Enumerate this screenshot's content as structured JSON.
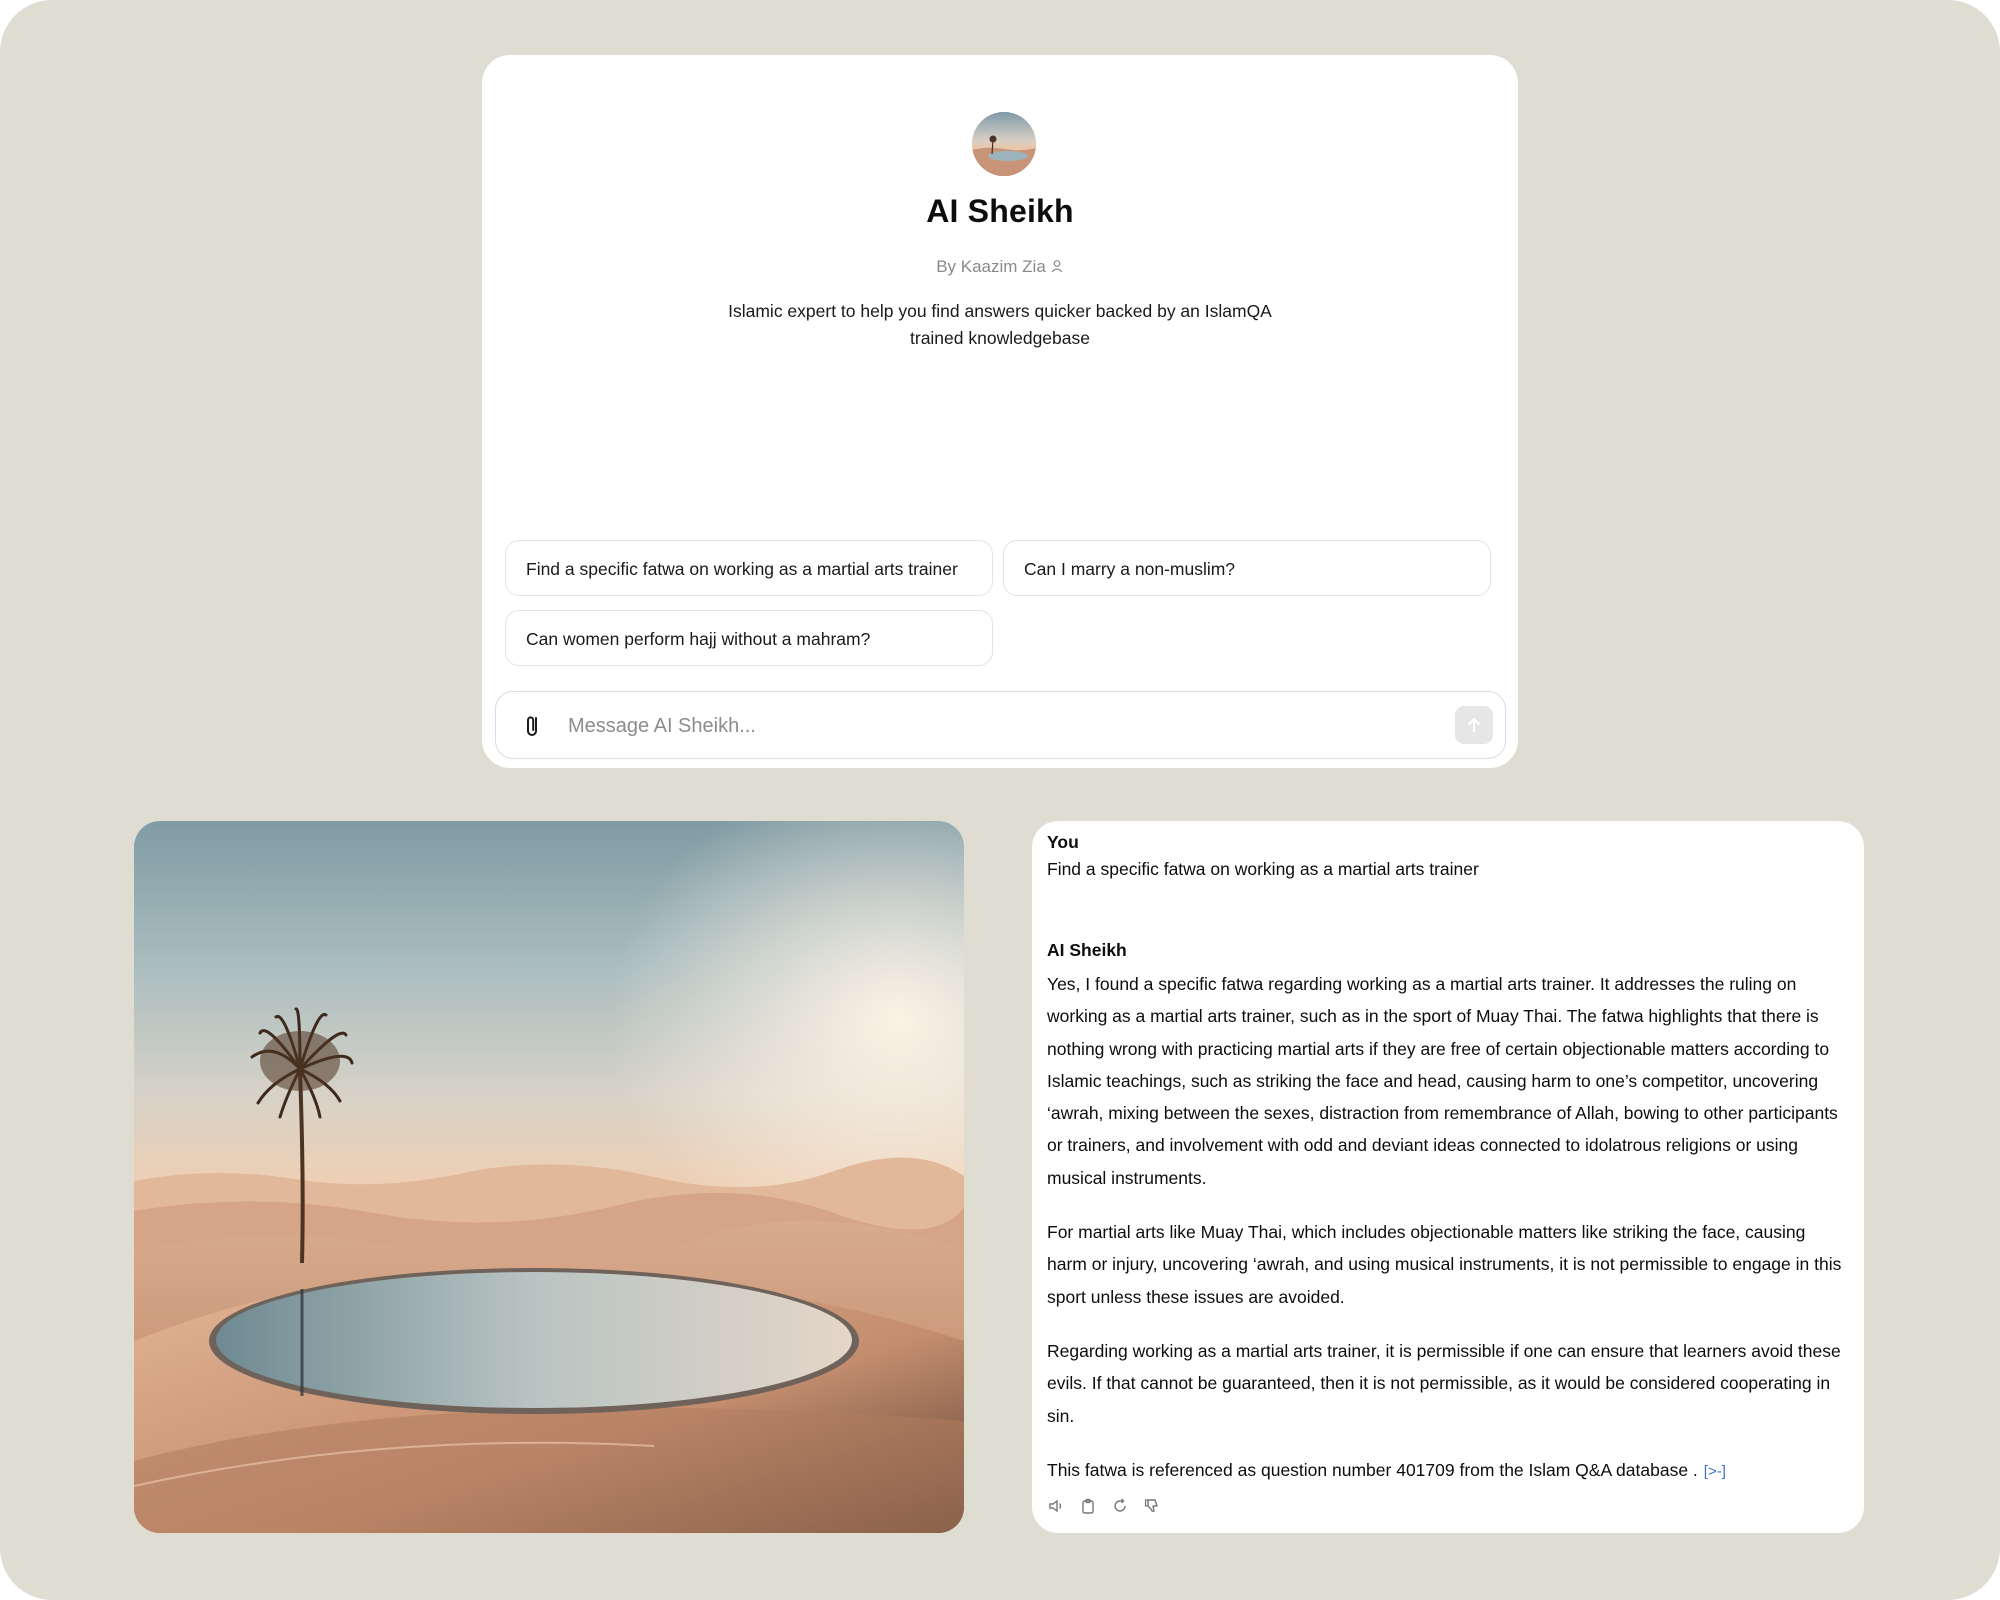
{
  "gpt": {
    "name": "AI Sheikh",
    "author": "By Kaazim Zia",
    "description": "Islamic expert to help you find answers quicker backed by an IslamQA trained knowledgebase",
    "starters": [
      "Find a specific fatwa on working as a martial arts trainer",
      "Can I marry a non-muslim?",
      "Can women perform hajj without a mahram?"
    ],
    "composer": {
      "placeholder": "Message AI Sheikh...",
      "attach_icon": "paperclip-icon",
      "send_icon": "arrow-up-icon"
    }
  },
  "image": {
    "description_icon": "desert-oasis-illustration"
  },
  "chat": {
    "user_label": "You",
    "user_message": "Find a specific fatwa on working as a martial arts trainer",
    "assistant_label": "AI Sheikh",
    "paragraphs": [
      "Yes, I found a specific fatwa regarding working as a martial arts trainer. It addresses the ruling on working as a martial arts trainer, such as in the sport of Muay Thai. The fatwa highlights that there is nothing wrong with practicing martial arts if they are free of certain objectionable matters according to Islamic teachings, such as striking the face and head, causing harm to one’s competitor, uncovering ‘awrah, mixing between the sexes, distraction from remembrance of Allah, bowing to other participants or trainers, and involvement with odd and deviant ideas connected to idolatrous religions or using musical instruments.",
      "For martial arts like Muay Thai, which includes objectionable matters like striking the face, causing harm or injury, uncovering ‘awrah, and using musical instruments, it is not permissible to engage in this sport unless these issues are avoided.",
      "Regarding working as a martial arts trainer, it is permissible if one can ensure that learners avoid these evils. If that cannot be guaranteed, then it is not permissible, as it would be considered cooperating in sin.",
      "This fatwa is referenced as question number 401709 from the Islam Q&A database ."
    ],
    "citation_marker": "[>-]",
    "actions": [
      "speaker-icon",
      "copy-icon",
      "regenerate-icon",
      "thumbs-down-icon"
    ]
  },
  "colors": {
    "background": "#dfdcd1",
    "card": "#ffffff",
    "link": "#3b73c9"
  }
}
